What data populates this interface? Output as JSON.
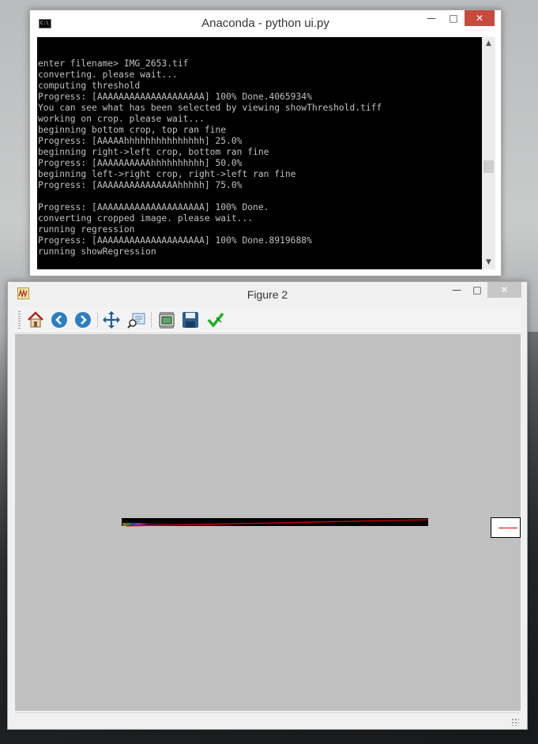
{
  "console": {
    "title": "Anaconda - python  ui.py",
    "icon_label": "C:\\",
    "controls": {
      "minimize": "—",
      "maximize": "□",
      "close": "✕"
    },
    "lines": [
      "enter filename> IMG_2653.tif",
      "converting. please wait...",
      "computing threshold",
      "Progress: [AAAAAAAAAAAAAAAAAAAA] 100% Done.4065934%",
      "You can see what has been selected by viewing showThreshold.tiff",
      "working on crop. please wait...",
      "beginning bottom crop, top ran fine",
      "Progress: [AAAAAhhhhhhhhhhhhhhh] 25.0%",
      "beginning right->left crop, bottom ran fine",
      "Progress: [AAAAAAAAAAhhhhhhhhhh] 50.0%",
      "beginning left->right crop, right->left ran fine",
      "Progress: [AAAAAAAAAAAAAAAhhhhh] 75.0%",
      "",
      "Progress: [AAAAAAAAAAAAAAAAAAAA] 100% Done.",
      "converting cropped image. please wait...",
      "running regression",
      "Progress: [AAAAAAAAAAAAAAAAAAAA] 100% Done.8919688%",
      "running showRegression"
    ],
    "scrollbar": {
      "up": "▲",
      "down": "▼"
    }
  },
  "figure": {
    "title": "Figure 2",
    "controls": {
      "minimize": "—",
      "maximize": "□",
      "close": "✕"
    },
    "toolbar": [
      {
        "name": "home-icon",
        "tooltip": "Reset original view"
      },
      {
        "name": "back-icon",
        "tooltip": "Back to previous view"
      },
      {
        "name": "forward-icon",
        "tooltip": "Forward to next view"
      },
      {
        "name": "pan-icon",
        "tooltip": "Pan axes"
      },
      {
        "name": "zoom-icon",
        "tooltip": "Zoom to rectangle"
      },
      {
        "name": "subplots-icon",
        "tooltip": "Configure subplots"
      },
      {
        "name": "save-icon",
        "tooltip": "Save the figure"
      },
      {
        "name": "edit-icon",
        "tooltip": "Edit axis, curve and image parameters"
      }
    ],
    "legend_colors": {
      "regression_line": "#e00000"
    },
    "status_text": ""
  }
}
